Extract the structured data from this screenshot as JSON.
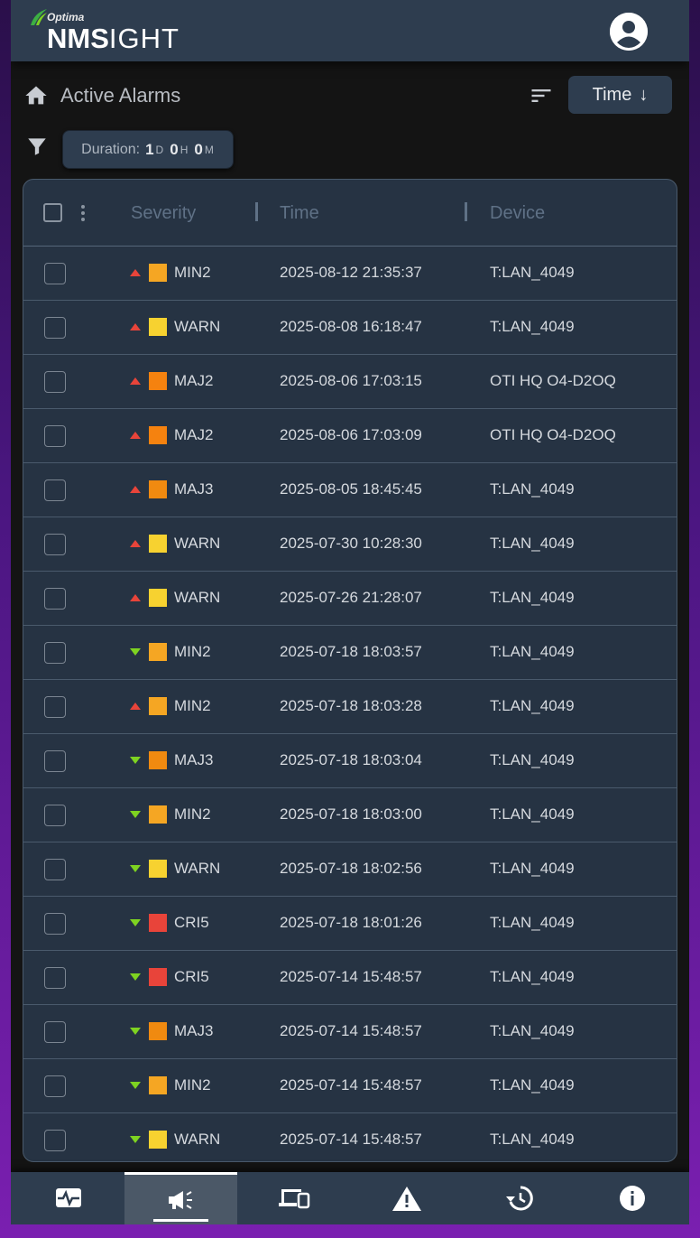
{
  "header": {
    "logo_small": "Optima",
    "logo_bold": "NMS",
    "logo_light": "IGHT"
  },
  "titlebar": {
    "title": "Active Alarms",
    "sort_label": "Time",
    "sort_arrow": "↓"
  },
  "filter": {
    "duration_label": "Duration:",
    "days": "1",
    "days_unit": "D",
    "hours": "0",
    "hours_unit": "H",
    "minutes": "0",
    "minutes_unit": "M"
  },
  "table": {
    "columns": [
      "Severity",
      "Time",
      "Device"
    ],
    "rows": [
      {
        "trend": "up",
        "severity": "MIN2",
        "color": "#f5a623",
        "time": "2025-08-12 21:35:37",
        "device": "T:LAN_4049"
      },
      {
        "trend": "up",
        "severity": "WARN",
        "color": "#f7d230",
        "time": "2025-08-08 16:18:47",
        "device": "T:LAN_4049"
      },
      {
        "trend": "up",
        "severity": "MAJ2",
        "color": "#f5820f",
        "time": "2025-08-06 17:03:15",
        "device": "OTI HQ O4-D2OQ"
      },
      {
        "trend": "up",
        "severity": "MAJ2",
        "color": "#f5820f",
        "time": "2025-08-06 17:03:09",
        "device": "OTI HQ O4-D2OQ"
      },
      {
        "trend": "up",
        "severity": "MAJ3",
        "color": "#f08a10",
        "time": "2025-08-05 18:45:45",
        "device": "T:LAN_4049"
      },
      {
        "trend": "up",
        "severity": "WARN",
        "color": "#f7d230",
        "time": "2025-07-30 10:28:30",
        "device": "T:LAN_4049"
      },
      {
        "trend": "up",
        "severity": "WARN",
        "color": "#f7d230",
        "time": "2025-07-26 21:28:07",
        "device": "T:LAN_4049"
      },
      {
        "trend": "down",
        "severity": "MIN2",
        "color": "#f5a623",
        "time": "2025-07-18 18:03:57",
        "device": "T:LAN_4049"
      },
      {
        "trend": "up",
        "severity": "MIN2",
        "color": "#f5a623",
        "time": "2025-07-18 18:03:28",
        "device": "T:LAN_4049"
      },
      {
        "trend": "down",
        "severity": "MAJ3",
        "color": "#f08a10",
        "time": "2025-07-18 18:03:04",
        "device": "T:LAN_4049"
      },
      {
        "trend": "down",
        "severity": "MIN2",
        "color": "#f5a623",
        "time": "2025-07-18 18:03:00",
        "device": "T:LAN_4049"
      },
      {
        "trend": "down",
        "severity": "WARN",
        "color": "#f7d230",
        "time": "2025-07-18 18:02:56",
        "device": "T:LAN_4049"
      },
      {
        "trend": "down",
        "severity": "CRI5",
        "color": "#e8443a",
        "time": "2025-07-18 18:01:26",
        "device": "T:LAN_4049"
      },
      {
        "trend": "down",
        "severity": "CRI5",
        "color": "#e8443a",
        "time": "2025-07-14 15:48:57",
        "device": "T:LAN_4049"
      },
      {
        "trend": "down",
        "severity": "MAJ3",
        "color": "#f08a10",
        "time": "2025-07-14 15:48:57",
        "device": "T:LAN_4049"
      },
      {
        "trend": "down",
        "severity": "MIN2",
        "color": "#f5a623",
        "time": "2025-07-14 15:48:57",
        "device": "T:LAN_4049"
      },
      {
        "trend": "down",
        "severity": "WARN",
        "color": "#f7d230",
        "time": "2025-07-14 15:48:57",
        "device": "T:LAN_4049"
      }
    ]
  },
  "bottomnav": {
    "items": [
      {
        "icon": "monitor-pulse-icon",
        "active": false
      },
      {
        "icon": "megaphone-icon",
        "active": true
      },
      {
        "icon": "devices-icon",
        "active": false
      },
      {
        "icon": "warning-icon",
        "active": false
      },
      {
        "icon": "history-icon",
        "active": false
      },
      {
        "icon": "info-icon",
        "active": false
      }
    ]
  }
}
